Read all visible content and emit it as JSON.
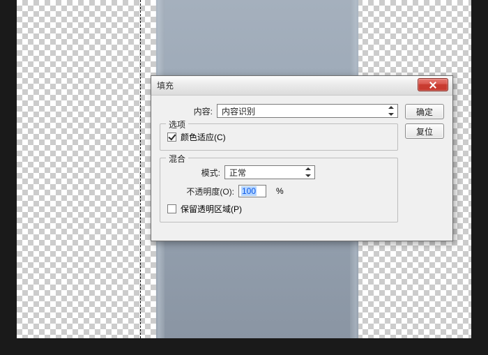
{
  "dialog": {
    "title": "填充",
    "content_label": "内容:",
    "content_value": "内容识别",
    "ok_label": "确定",
    "reset_label": "复位",
    "options": {
      "legend": "选项",
      "color_adapt_label": "颜色适应(C)",
      "color_adapt_checked": true
    },
    "blend": {
      "legend": "混合",
      "mode_label": "模式:",
      "mode_value": "正常",
      "opacity_label": "不透明度(O):",
      "opacity_value": "100",
      "opacity_unit": "%",
      "preserve_label": "保留透明区域(P)",
      "preserve_checked": false
    }
  }
}
